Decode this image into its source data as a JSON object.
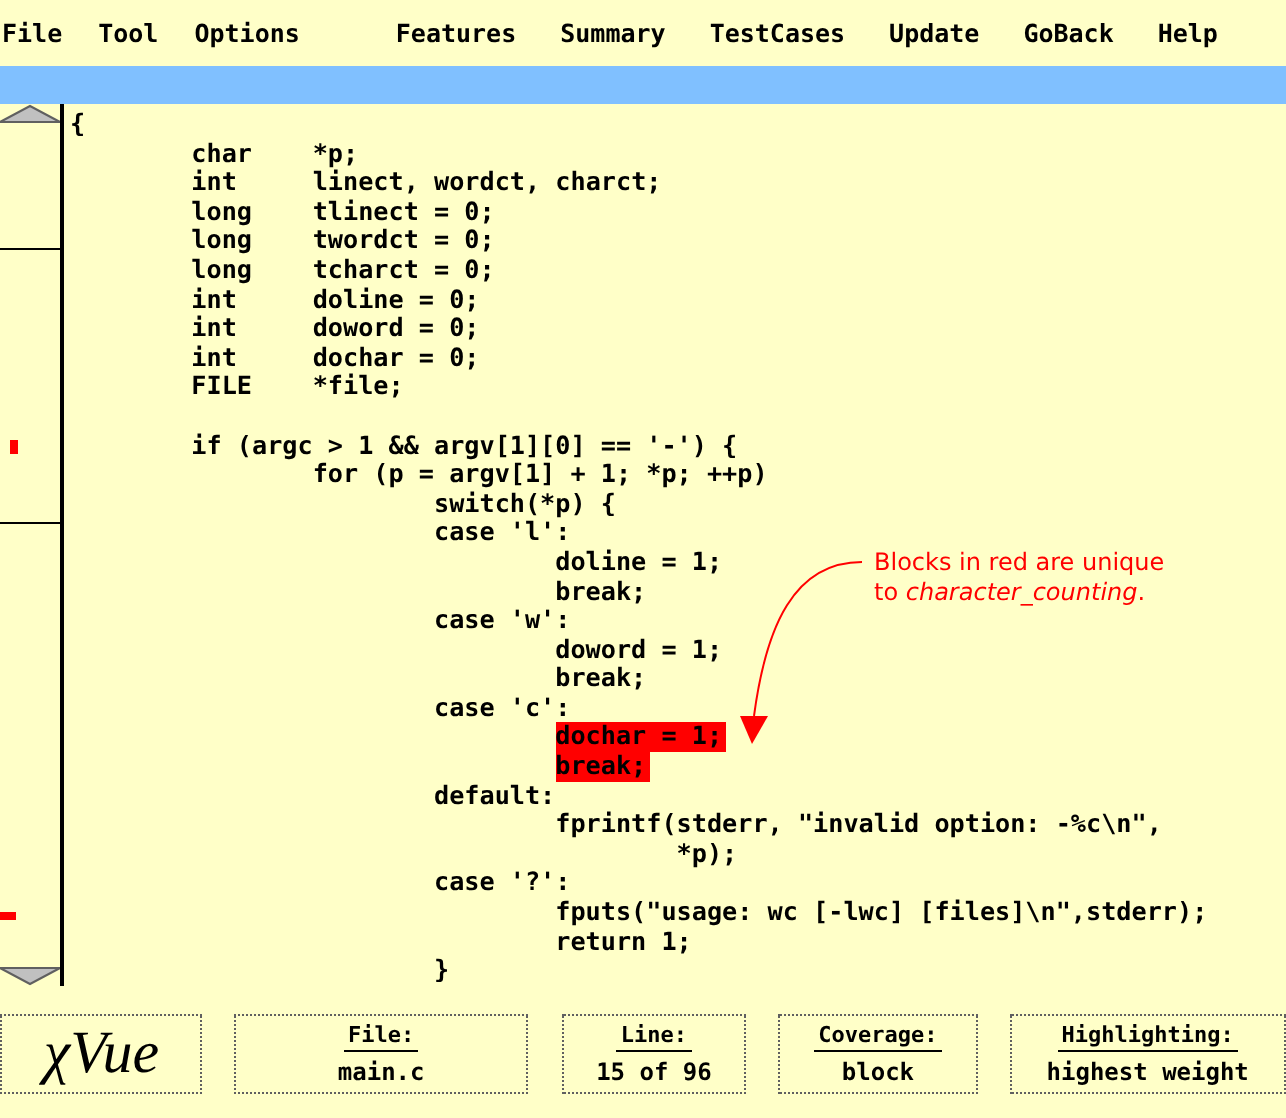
{
  "menu_left": [
    "File",
    "Tool",
    "Options"
  ],
  "menu_right": [
    "Features",
    "Summary",
    "TestCases",
    "Update",
    "GoBack",
    "Help"
  ],
  "code_lines": [
    {
      "text": "{",
      "highlighted": false
    },
    {
      "text": "\tchar\t*p;",
      "highlighted": false
    },
    {
      "text": "\tint\tlinect, wordct, charct;",
      "highlighted": false
    },
    {
      "text": "\tlong\ttlinect = 0;",
      "highlighted": false
    },
    {
      "text": "\tlong\ttwordct = 0;",
      "highlighted": false
    },
    {
      "text": "\tlong\ttcharct = 0;",
      "highlighted": false
    },
    {
      "text": "\tint\tdoline = 0;",
      "highlighted": false
    },
    {
      "text": "\tint\tdoword = 0;",
      "highlighted": false
    },
    {
      "text": "\tint\tdochar = 0;",
      "highlighted": false
    },
    {
      "text": "\tFILE\t*file;",
      "highlighted": false
    },
    {
      "text": "\tif (argc > 1 && argv[1][0] == '-') {",
      "highlighted": false,
      "spaced": true
    },
    {
      "text": "\t\tfor (p = argv[1] + 1; *p; ++p)",
      "highlighted": false
    },
    {
      "text": "\t\t\tswitch(*p) {",
      "highlighted": false
    },
    {
      "text": "\t\t\tcase 'l':",
      "highlighted": false
    },
    {
      "text": "\t\t\t\tdoline = 1;",
      "highlighted": false
    },
    {
      "text": "\t\t\t\tbreak;",
      "highlighted": false
    },
    {
      "text": "\t\t\tcase 'w':",
      "highlighted": false
    },
    {
      "text": "\t\t\t\tdoword = 1;",
      "highlighted": false
    },
    {
      "text": "\t\t\t\tbreak;",
      "highlighted": false
    },
    {
      "text": "\t\t\tcase 'c':",
      "highlighted": false
    },
    {
      "text": "\t\t\t\tdochar = 1;",
      "highlighted": true
    },
    {
      "text": "\t\t\t\tbreak;",
      "highlighted": true
    },
    {
      "text": "\t\t\tdefault:",
      "highlighted": false
    },
    {
      "text": "\t\t\t\tfprintf(stderr, \"invalid option: -%c\\n\",",
      "highlighted": false
    },
    {
      "text": "\t\t\t\t\t*p);",
      "highlighted": false
    },
    {
      "text": "\t\t\tcase '?':",
      "highlighted": false
    },
    {
      "text": "\t\t\t\tfputs(\"usage: wc [-lwc] [files]\\n\",stderr);",
      "highlighted": false
    },
    {
      "text": "\t\t\t\treturn 1;",
      "highlighted": false
    },
    {
      "text": "\t\t\t}",
      "highlighted": false
    }
  ],
  "annotation": [
    "Blocks in red are unique",
    "to *character_counting*."
  ],
  "status": {
    "logo": "χVue",
    "fields": [
      {
        "label": "File:",
        "value": "main.c"
      },
      {
        "label": "Line:",
        "value": "15 of 96"
      },
      {
        "label": "Coverage:",
        "value": "block"
      },
      {
        "label": "Highlighting:",
        "value": "highest weight"
      }
    ]
  }
}
